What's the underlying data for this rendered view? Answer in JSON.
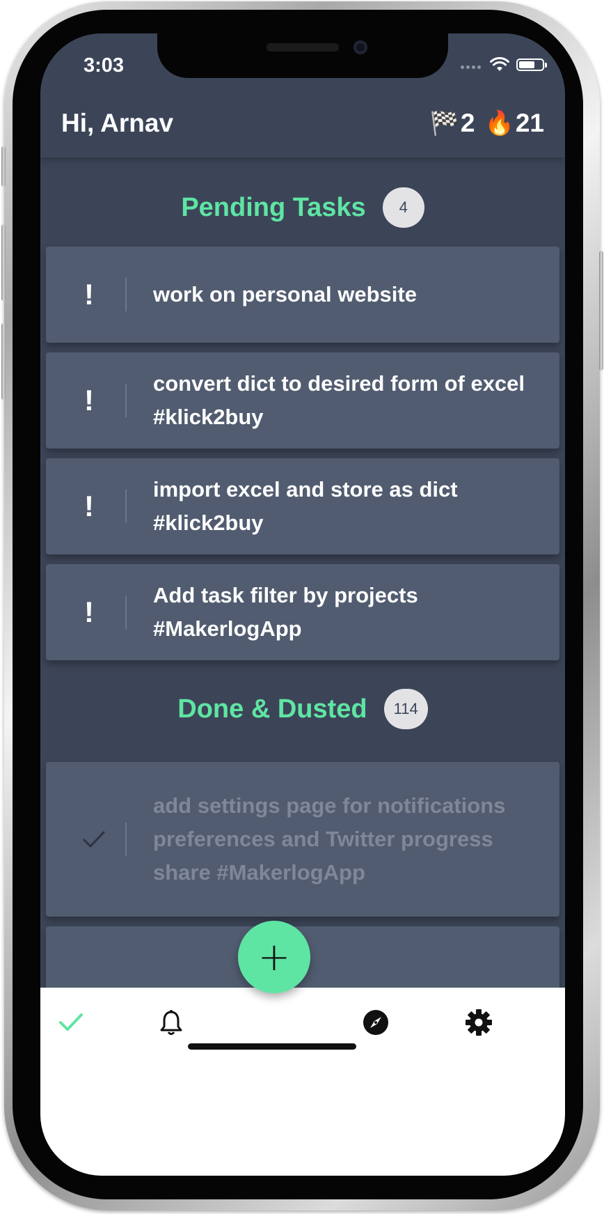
{
  "status_bar": {
    "time": "3:03"
  },
  "header": {
    "greeting": "Hi, Arnav",
    "stats": [
      {
        "icon": "checkered-flag-icon",
        "glyph": "🏁",
        "value": "2"
      },
      {
        "icon": "fire-icon",
        "glyph": "🔥",
        "value": "21"
      }
    ]
  },
  "pending": {
    "title": "Pending Tasks",
    "count": "4",
    "tasks": [
      {
        "text": "work on personal website",
        "marker": "!"
      },
      {
        "text": "convert dict to desired form of excel #klick2buy",
        "marker": "!"
      },
      {
        "text": "import excel and store as dict #klick2buy",
        "marker": "!"
      },
      {
        "text": "Add task filter by projects #MakerlogApp",
        "marker": "!"
      }
    ]
  },
  "done": {
    "title": "Done & Dusted",
    "count": "114",
    "tasks": [
      {
        "text": "add settings page for notifications preferences and Twitter progress share #MakerlogApp"
      }
    ]
  },
  "fab": {
    "label": "+"
  },
  "nav": {
    "items": [
      "tasks-check-icon",
      "bell-icon",
      "compass-icon",
      "gear-icon"
    ],
    "accent": "#5fe5a3"
  },
  "colors": {
    "accent": "#5fe5a3",
    "background": "#3c4558",
    "card": "#515c70"
  }
}
